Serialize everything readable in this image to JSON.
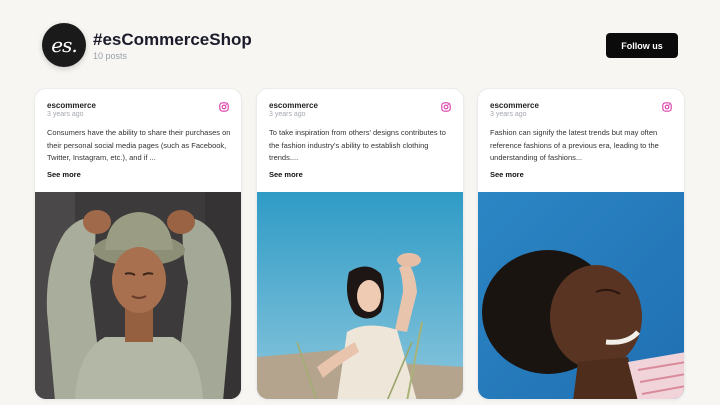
{
  "profile": {
    "logo_text": "es.",
    "name": "#esCommerceShop",
    "posts_count": "10 posts",
    "follow_label": "Follow us"
  },
  "posts": [
    {
      "author": "escommerce",
      "time": "3 years ago",
      "text": "Consumers have the ability to share their purchases on their personal social media pages (such as Facebook, Twitter, Instagram, etc.), and if ...",
      "see_more": "See more",
      "icon": "instagram-icon"
    },
    {
      "author": "escommerce",
      "time": "3 years ago",
      "text": "To take inspiration from others' designs contributes to the fashion industry's ability to establish clothing trends....",
      "see_more": "See more",
      "icon": "instagram-icon"
    },
    {
      "author": "escommerce",
      "time": "3 years ago",
      "text": "Fashion can signify the latest trends but may often reference fashions of a previous era, leading to the understanding of fashions...",
      "see_more": "See more",
      "icon": "instagram-icon"
    }
  ],
  "colors": {
    "background": "#f7f6f2",
    "button": "#0b0b0b",
    "instagram": "#d6249f"
  }
}
